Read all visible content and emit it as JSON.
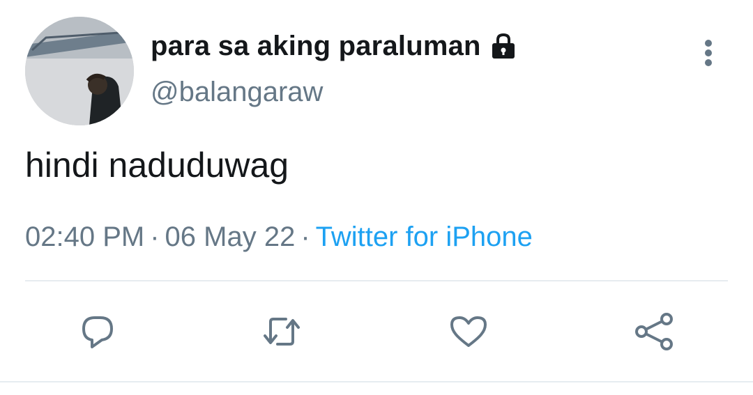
{
  "tweet": {
    "display_name": "para sa aking paraluman",
    "protected_icon": "lock-icon",
    "handle": "@balangaraw",
    "text": "hindi naduduwag",
    "time": "02:40 PM",
    "separator": "·",
    "date": "06 May 22",
    "source": "Twitter for iPhone"
  },
  "actions": {
    "reply": "reply-icon",
    "retweet": "retweet-icon",
    "like": "heart-icon",
    "share": "share-icon"
  },
  "colors": {
    "text_primary": "#14171a",
    "text_secondary": "#657786",
    "accent": "#1da1f2",
    "divider": "#e6ecf0"
  }
}
